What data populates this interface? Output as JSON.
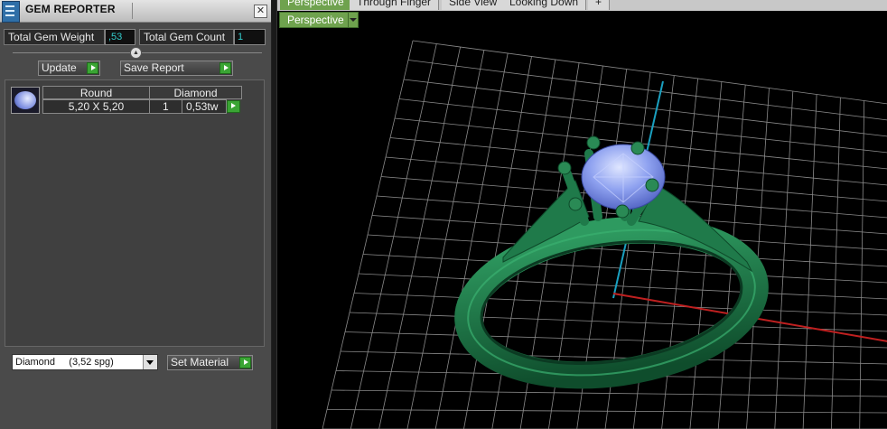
{
  "panel": {
    "title": "GEM REPORTER",
    "close_icon": "close-icon",
    "total_gem_weight_label": "Total Gem Weight",
    "total_gem_weight_value": ",53",
    "total_gem_count_label": "Total Gem Count",
    "total_gem_count_value": "1",
    "update_label": "Update",
    "save_report_label": "Save Report",
    "gem_table": {
      "headers": [
        "Round",
        "Diamond"
      ],
      "row": {
        "size": "5,20 X 5,20",
        "count": "1",
        "weight": "0,53tw"
      }
    },
    "material_selected": "Diamond     (3,52 spg)",
    "set_material_label": "Set Material"
  },
  "viewport": {
    "tabs": [
      "Perspective",
      "Through Finger",
      "Side View",
      "Looking Down",
      "+"
    ],
    "active_tab": "Perspective",
    "view_menu_label": "Perspective"
  },
  "colors": {
    "accent_green": "#6fa24e",
    "ring_green": "#1f7a4a",
    "gem_blue": "#8fa2f0",
    "value_cyan": "#33cccc"
  }
}
